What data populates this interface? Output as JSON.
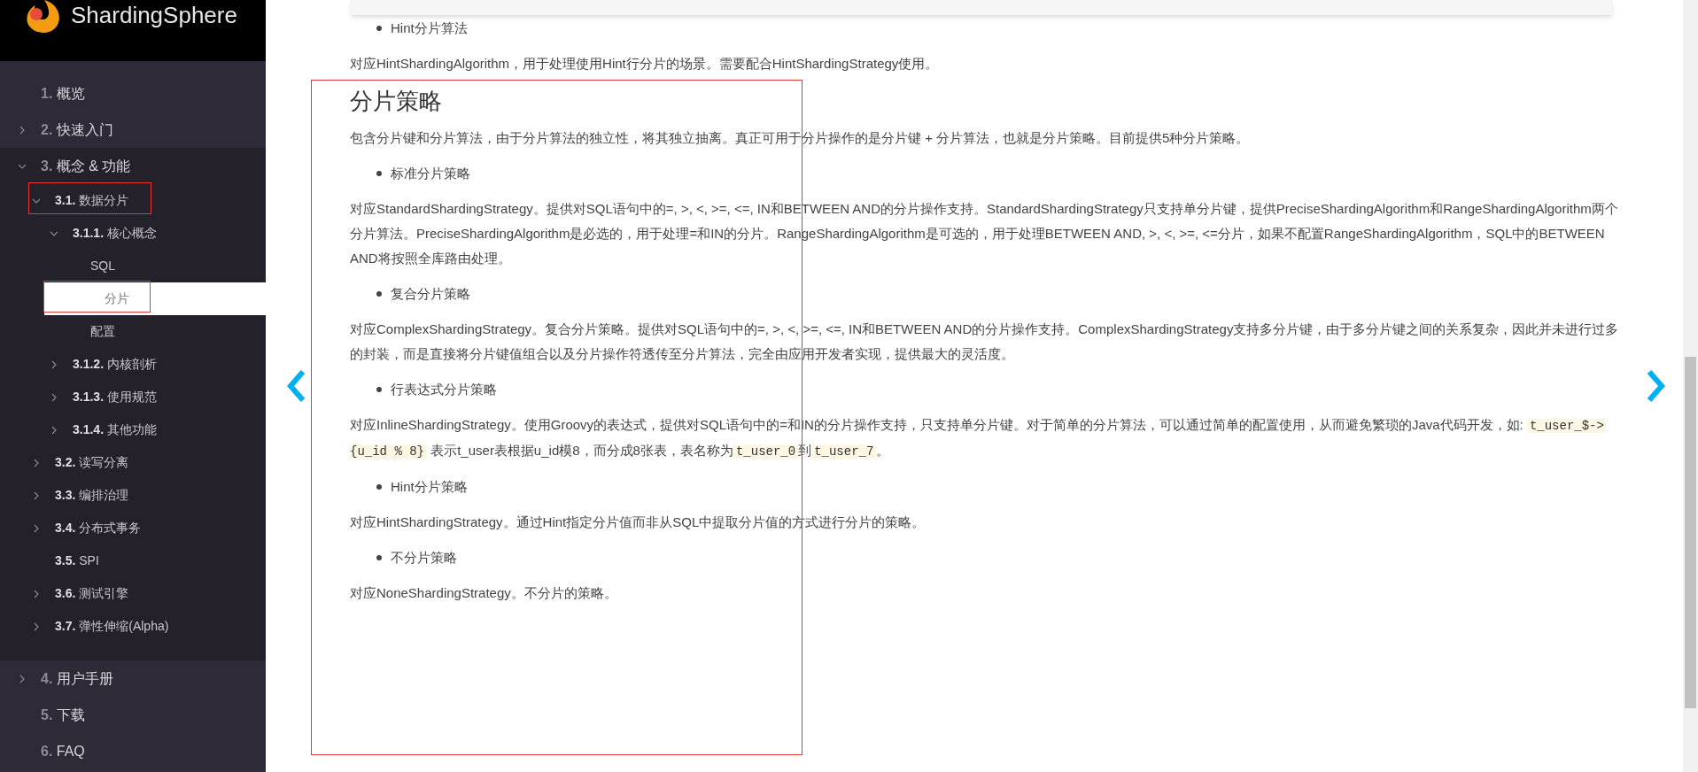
{
  "logo": {
    "text": "ShardingSphere"
  },
  "sidebar": {
    "items": [
      {
        "number": "1.",
        "label": "概览",
        "selected": false
      },
      {
        "number": "2.",
        "label": "快速入门",
        "expanded": false,
        "selected": false
      },
      {
        "number": "3.",
        "label": "概念 & 功能",
        "expanded": true,
        "selected": false,
        "children": [
          {
            "number": "3.1.",
            "label": "数据分片",
            "expanded": true,
            "selected": false,
            "children": [
              {
                "number": "3.1.1.",
                "label": "核心概念",
                "expanded": true,
                "selected": false,
                "children": [
                  {
                    "label": "SQL",
                    "selected": false
                  },
                  {
                    "label": "分片",
                    "selected": true
                  },
                  {
                    "label": "配置",
                    "selected": false
                  }
                ]
              },
              {
                "number": "3.1.2.",
                "label": "内核剖析",
                "expanded": false,
                "selected": false
              },
              {
                "number": "3.1.3.",
                "label": "使用规范",
                "expanded": false,
                "selected": false
              },
              {
                "number": "3.1.4.",
                "label": "其他功能",
                "expanded": false,
                "selected": false
              }
            ]
          },
          {
            "number": "3.2.",
            "label": "读写分离",
            "expanded": false,
            "selected": false
          },
          {
            "number": "3.3.",
            "label": "编排治理",
            "expanded": false,
            "selected": false
          },
          {
            "number": "3.4.",
            "label": "分布式事务",
            "expanded": false,
            "selected": false
          },
          {
            "number": "3.5.",
            "label": "SPI",
            "selected": false
          },
          {
            "number": "3.6.",
            "label": "测试引擎",
            "expanded": false,
            "selected": false
          },
          {
            "number": "3.7.",
            "label": "弹性伸缩(Alpha)",
            "expanded": false,
            "selected": false
          }
        ]
      },
      {
        "number": "4.",
        "label": "用户手册",
        "expanded": false,
        "selected": false
      },
      {
        "number": "5.",
        "label": "下载",
        "selected": false
      },
      {
        "number": "6.",
        "label": "FAQ",
        "selected": false
      }
    ]
  },
  "content": [
    {
      "kind": "bullet",
      "text": "Hint分片算法"
    },
    {
      "kind": "paragraph",
      "parts": [
        {
          "kind": "text",
          "text": "对应HintShardingAlgorithm，用于处理使用Hint行分片的场景。需要配合HintShardingStrategy使用。"
        }
      ]
    },
    {
      "kind": "heading",
      "text": "分片策略"
    },
    {
      "kind": "paragraph",
      "parts": [
        {
          "kind": "text",
          "text": "包含分片键和分片算法，由于分片算法的独立性，将其独立抽离。真正可用于分片操作的是分片键 + 分片算法，也就是分片策略。目前提供5种分片策略。"
        }
      ]
    },
    {
      "kind": "bullet",
      "text": "标准分片策略"
    },
    {
      "kind": "paragraph",
      "parts": [
        {
          "kind": "text",
          "text": "对应StandardShardingStrategy。提供对SQL语句中的=, >, <, >=, <=, IN和BETWEEN AND的分片操作支持。StandardShardingStrategy只支持单分片键，提供PreciseShardingAlgorithm和RangeShardingAlgorithm两个分片算法。PreciseShardingAlgorithm是必选的，用于处理=和IN的分片。RangeShardingAlgorithm是可选的，用于处理BETWEEN AND, >, <, >=, <=分片，如果不配置RangeShardingAlgorithm，SQL中的BETWEEN AND将按照全库路由处理。"
        }
      ]
    },
    {
      "kind": "bullet",
      "text": "复合分片策略"
    },
    {
      "kind": "paragraph",
      "parts": [
        {
          "kind": "text",
          "text": "对应ComplexShardingStrategy。复合分片策略。提供对SQL语句中的=, >, <, >=, <=, IN和BETWEEN AND的分片操作支持。ComplexShardingStrategy支持多分片键，由于多分片键之间的关系复杂，因此并未进行过多的封装，而是直接将分片键值组合以及分片操作符透传至分片算法，完全由应用开发者实现，提供最大的灵活度。"
        }
      ]
    },
    {
      "kind": "bullet",
      "text": "行表达式分片策略"
    },
    {
      "kind": "paragraph",
      "parts": [
        {
          "kind": "text",
          "text": "对应InlineShardingStrategy。使用Groovy的表达式，提供对SQL语句中的=和IN的分片操作支持，只支持单分片键。对于简单的分片算法，可以通过简单的配置使用，从而避免繁琐的Java代码开发，如: "
        },
        {
          "kind": "code",
          "text": "t_user_$->{u_id % 8}"
        },
        {
          "kind": "text",
          "text": " 表示t_user表根据u_id模8，而分成8张表，表名称为"
        },
        {
          "kind": "code",
          "text": "t_user_0"
        },
        {
          "kind": "text",
          "text": "到"
        },
        {
          "kind": "code",
          "text": "t_user_7"
        },
        {
          "kind": "text",
          "text": "。"
        }
      ]
    },
    {
      "kind": "bullet",
      "text": "Hint分片策略"
    },
    {
      "kind": "paragraph",
      "parts": [
        {
          "kind": "text",
          "text": "对应HintShardingStrategy。通过Hint指定分片值而非从SQL中提取分片值的方式进行分片的策略。"
        }
      ]
    },
    {
      "kind": "bullet",
      "text": "不分片策略"
    },
    {
      "kind": "paragraph",
      "parts": [
        {
          "kind": "text",
          "text": "对应NoneShardingStrategy。不分片的策略。"
        }
      ]
    }
  ]
}
